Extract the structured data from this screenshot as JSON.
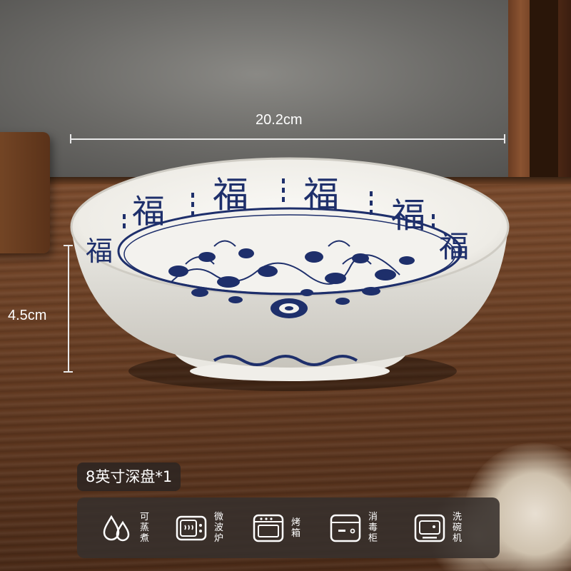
{
  "dimensions": {
    "diameter": "20.2cm",
    "height": "4.5cm"
  },
  "product": {
    "badge": "8英寸深盘*1",
    "bowl_characters": [
      "福",
      "福",
      "福",
      "福",
      "福",
      "福"
    ]
  },
  "features": [
    {
      "icon": "water-drops-icon",
      "label": "可蒸煮"
    },
    {
      "icon": "microwave-icon",
      "label": "微波炉"
    },
    {
      "icon": "oven-icon",
      "label": "烤箱"
    },
    {
      "icon": "sterilizer-cabinet-icon",
      "label": "消毒柜"
    },
    {
      "icon": "dishwasher-icon",
      "label": "洗碗机"
    }
  ],
  "colors": {
    "porcelain": "#f2f1ee",
    "cobalt": "#1e2f6b",
    "overlay": "#37302c"
  }
}
